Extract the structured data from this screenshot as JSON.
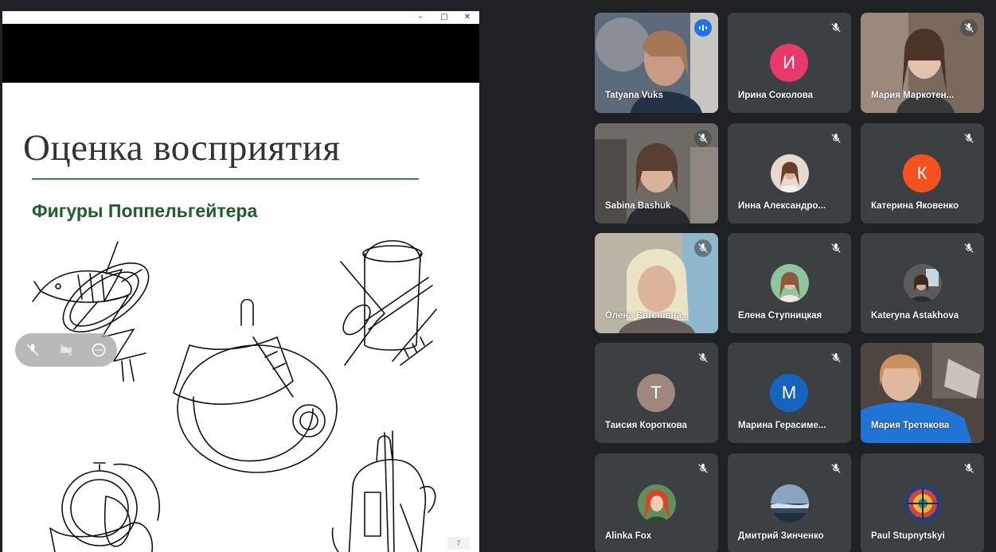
{
  "window": {
    "minimize_label": "–",
    "restore_label": "▢",
    "close_label": "✕"
  },
  "slide": {
    "title": "Оценка восприятия",
    "subtitle": "Фигуры Поппельгейтера",
    "page_number": "7",
    "accent_color": "#2e8b46"
  },
  "controls": {
    "icons": [
      "mic-off-icon",
      "video-off-icon",
      "more-icon"
    ]
  },
  "participants": [
    {
      "name": "Tatyana Vuks",
      "type": "video",
      "speaking": true
    },
    {
      "name": "Ирина Соколова",
      "type": "letter",
      "letter": "И",
      "color": "#e8396a",
      "muted": true
    },
    {
      "name": "Мария Маркотен...",
      "type": "video",
      "muted": true
    },
    {
      "name": "Sabina Bashuk",
      "type": "video",
      "muted": true
    },
    {
      "name": "Инна Александро...",
      "type": "photo",
      "muted": true
    },
    {
      "name": "Катерина Яковенко",
      "type": "letter",
      "letter": "К",
      "color": "#f4511e",
      "muted": true
    },
    {
      "name": "Олена Євгенівна...",
      "type": "video",
      "muted": true
    },
    {
      "name": "Елена Ступницкая",
      "type": "photo",
      "muted": true
    },
    {
      "name": "Kateryna Astakhova",
      "type": "photo",
      "muted": true
    },
    {
      "name": "Таисия Короткова",
      "type": "letter",
      "letter": "Т",
      "color": "#a1887f",
      "muted": true
    },
    {
      "name": "Марина Герасиме...",
      "type": "letter",
      "letter": "М",
      "color": "#1565c0",
      "muted": true
    },
    {
      "name": "Мария Третякова",
      "type": "video",
      "muted": false
    },
    {
      "name": "Alinka Fox",
      "type": "photo",
      "muted": true
    },
    {
      "name": "Дмитрий Зинченко",
      "type": "photo",
      "muted": true
    },
    {
      "name": "Paul Stupnytskyi",
      "type": "photo",
      "muted": true
    }
  ]
}
